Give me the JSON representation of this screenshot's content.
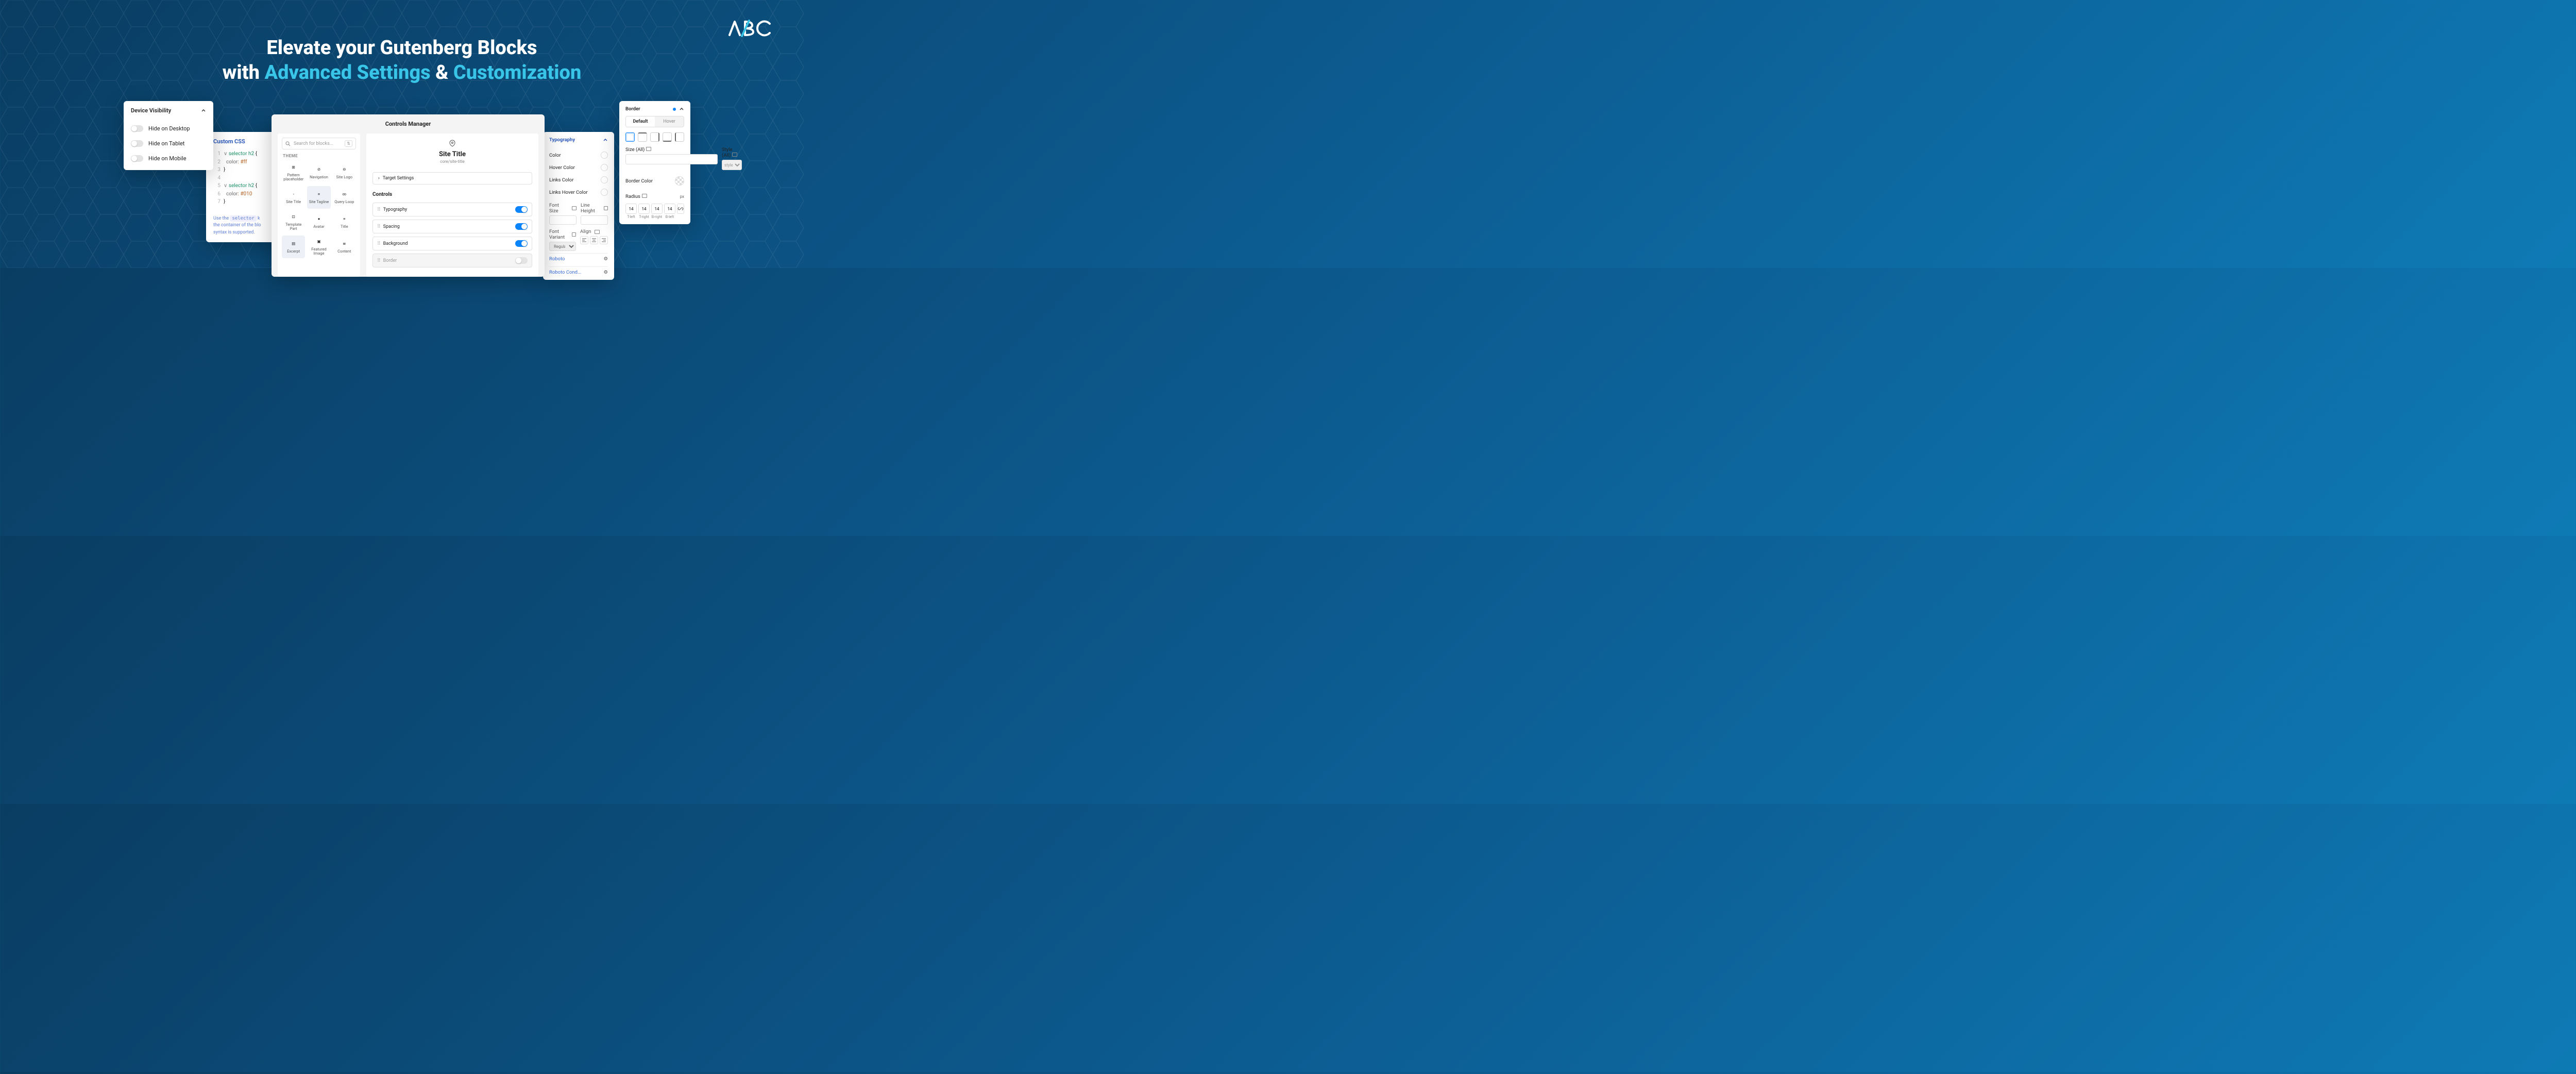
{
  "logo": "ABC",
  "headline": {
    "l1": "Elevate your Gutenberg Blocks",
    "l2a": "with ",
    "l2b": "Advanced Settings",
    "l2c": " & ",
    "l2d": "Customization"
  },
  "device": {
    "title": "Device Visibility",
    "opts": [
      "Hide on Desktop",
      "Hide on Tablet",
      "Hide on Mobile"
    ]
  },
  "css": {
    "title": "Custom CSS",
    "code": [
      {
        "n": "1",
        "sel": "selector h2",
        "brace": " {"
      },
      {
        "n": "2",
        "prop": "  color",
        "val": ": #ff"
      },
      {
        "n": "3",
        "brace": "}"
      },
      {
        "n": "4",
        "blank": " "
      },
      {
        "n": "5",
        "sel": "selector h2",
        "brace": " {"
      },
      {
        "n": "6",
        "prop": "  color",
        "val": ": #010"
      },
      {
        "n": "7",
        "brace": "}"
      }
    ],
    "hint_a": "Use the ",
    "hint_code": "selector",
    "hint_b": " k",
    "hint_c": "the container of the blo",
    "hint_d": "syntax is supported."
  },
  "manager": {
    "title": "Controls Manager",
    "search_placeholder": "Search for blocks...",
    "theme_label": "THEME",
    "blocks": [
      {
        "name": "Pattern placeholder",
        "icon": "⊞"
      },
      {
        "name": "Navigation",
        "icon": "⊘"
      },
      {
        "name": "Site Logo",
        "icon": "⊖"
      },
      {
        "name": "Site Title",
        "icon": "◦"
      },
      {
        "name": "Site Tagline",
        "icon": "≡",
        "active": true
      },
      {
        "name": "Query Loop",
        "icon": "∞"
      },
      {
        "name": "Template Part",
        "icon": "⊡"
      },
      {
        "name": "Avatar",
        "icon": "●"
      },
      {
        "name": "Title",
        "icon": "≡"
      },
      {
        "name": "Excerpt",
        "icon": "▤",
        "active": true
      },
      {
        "name": "Featured Image",
        "icon": "▣"
      },
      {
        "name": "Content",
        "icon": "≣"
      }
    ],
    "site_title": "Site Title",
    "slug": "core/site-title",
    "target": "Target Settings",
    "controls_label": "Controls",
    "controls": [
      {
        "name": "Typography",
        "on": true
      },
      {
        "name": "Spacing",
        "on": true
      },
      {
        "name": "Background",
        "on": true
      },
      {
        "name": "Border",
        "on": false
      }
    ]
  },
  "typo": {
    "title": "Typography",
    "rows": [
      "Color",
      "Hover Color",
      "Links Color",
      "Links Hover Color"
    ],
    "font_size": "Font Size",
    "line_height": "Line Height",
    "font_variant": "Font Variant",
    "align": "Align",
    "variant_value": "Regular",
    "fonts": [
      "Roboto",
      "Roboto Cond..."
    ]
  },
  "border": {
    "title": "Border",
    "tabs": [
      "Default",
      "Hover"
    ],
    "size_label": "Size (All)",
    "style_label": "Style (All)",
    "style_value": "style",
    "color_label": "Border Color",
    "radius_label": "Radius",
    "radius_unit": "px",
    "radius_vals": [
      "14",
      "14",
      "14",
      "14"
    ],
    "radius_sides": [
      "T-left",
      "T-right",
      "B-right",
      "B-left"
    ]
  }
}
